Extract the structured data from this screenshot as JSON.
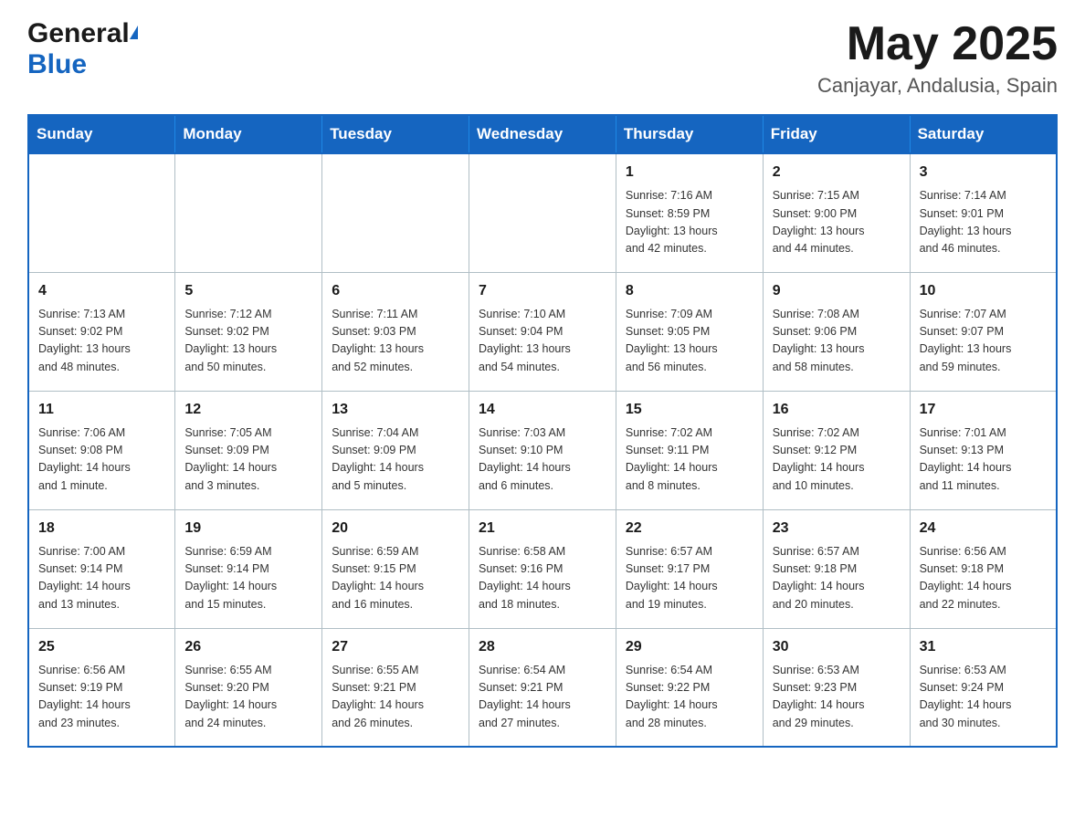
{
  "header": {
    "logo_general": "General",
    "logo_blue": "Blue",
    "month_title": "May 2025",
    "location": "Canjayar, Andalusia, Spain"
  },
  "weekdays": [
    "Sunday",
    "Monday",
    "Tuesday",
    "Wednesday",
    "Thursday",
    "Friday",
    "Saturday"
  ],
  "weeks": [
    [
      {
        "day": "",
        "info": ""
      },
      {
        "day": "",
        "info": ""
      },
      {
        "day": "",
        "info": ""
      },
      {
        "day": "",
        "info": ""
      },
      {
        "day": "1",
        "info": "Sunrise: 7:16 AM\nSunset: 8:59 PM\nDaylight: 13 hours\nand 42 minutes."
      },
      {
        "day": "2",
        "info": "Sunrise: 7:15 AM\nSunset: 9:00 PM\nDaylight: 13 hours\nand 44 minutes."
      },
      {
        "day": "3",
        "info": "Sunrise: 7:14 AM\nSunset: 9:01 PM\nDaylight: 13 hours\nand 46 minutes."
      }
    ],
    [
      {
        "day": "4",
        "info": "Sunrise: 7:13 AM\nSunset: 9:02 PM\nDaylight: 13 hours\nand 48 minutes."
      },
      {
        "day": "5",
        "info": "Sunrise: 7:12 AM\nSunset: 9:02 PM\nDaylight: 13 hours\nand 50 minutes."
      },
      {
        "day": "6",
        "info": "Sunrise: 7:11 AM\nSunset: 9:03 PM\nDaylight: 13 hours\nand 52 minutes."
      },
      {
        "day": "7",
        "info": "Sunrise: 7:10 AM\nSunset: 9:04 PM\nDaylight: 13 hours\nand 54 minutes."
      },
      {
        "day": "8",
        "info": "Sunrise: 7:09 AM\nSunset: 9:05 PM\nDaylight: 13 hours\nand 56 minutes."
      },
      {
        "day": "9",
        "info": "Sunrise: 7:08 AM\nSunset: 9:06 PM\nDaylight: 13 hours\nand 58 minutes."
      },
      {
        "day": "10",
        "info": "Sunrise: 7:07 AM\nSunset: 9:07 PM\nDaylight: 13 hours\nand 59 minutes."
      }
    ],
    [
      {
        "day": "11",
        "info": "Sunrise: 7:06 AM\nSunset: 9:08 PM\nDaylight: 14 hours\nand 1 minute."
      },
      {
        "day": "12",
        "info": "Sunrise: 7:05 AM\nSunset: 9:09 PM\nDaylight: 14 hours\nand 3 minutes."
      },
      {
        "day": "13",
        "info": "Sunrise: 7:04 AM\nSunset: 9:09 PM\nDaylight: 14 hours\nand 5 minutes."
      },
      {
        "day": "14",
        "info": "Sunrise: 7:03 AM\nSunset: 9:10 PM\nDaylight: 14 hours\nand 6 minutes."
      },
      {
        "day": "15",
        "info": "Sunrise: 7:02 AM\nSunset: 9:11 PM\nDaylight: 14 hours\nand 8 minutes."
      },
      {
        "day": "16",
        "info": "Sunrise: 7:02 AM\nSunset: 9:12 PM\nDaylight: 14 hours\nand 10 minutes."
      },
      {
        "day": "17",
        "info": "Sunrise: 7:01 AM\nSunset: 9:13 PM\nDaylight: 14 hours\nand 11 minutes."
      }
    ],
    [
      {
        "day": "18",
        "info": "Sunrise: 7:00 AM\nSunset: 9:14 PM\nDaylight: 14 hours\nand 13 minutes."
      },
      {
        "day": "19",
        "info": "Sunrise: 6:59 AM\nSunset: 9:14 PM\nDaylight: 14 hours\nand 15 minutes."
      },
      {
        "day": "20",
        "info": "Sunrise: 6:59 AM\nSunset: 9:15 PM\nDaylight: 14 hours\nand 16 minutes."
      },
      {
        "day": "21",
        "info": "Sunrise: 6:58 AM\nSunset: 9:16 PM\nDaylight: 14 hours\nand 18 minutes."
      },
      {
        "day": "22",
        "info": "Sunrise: 6:57 AM\nSunset: 9:17 PM\nDaylight: 14 hours\nand 19 minutes."
      },
      {
        "day": "23",
        "info": "Sunrise: 6:57 AM\nSunset: 9:18 PM\nDaylight: 14 hours\nand 20 minutes."
      },
      {
        "day": "24",
        "info": "Sunrise: 6:56 AM\nSunset: 9:18 PM\nDaylight: 14 hours\nand 22 minutes."
      }
    ],
    [
      {
        "day": "25",
        "info": "Sunrise: 6:56 AM\nSunset: 9:19 PM\nDaylight: 14 hours\nand 23 minutes."
      },
      {
        "day": "26",
        "info": "Sunrise: 6:55 AM\nSunset: 9:20 PM\nDaylight: 14 hours\nand 24 minutes."
      },
      {
        "day": "27",
        "info": "Sunrise: 6:55 AM\nSunset: 9:21 PM\nDaylight: 14 hours\nand 26 minutes."
      },
      {
        "day": "28",
        "info": "Sunrise: 6:54 AM\nSunset: 9:21 PM\nDaylight: 14 hours\nand 27 minutes."
      },
      {
        "day": "29",
        "info": "Sunrise: 6:54 AM\nSunset: 9:22 PM\nDaylight: 14 hours\nand 28 minutes."
      },
      {
        "day": "30",
        "info": "Sunrise: 6:53 AM\nSunset: 9:23 PM\nDaylight: 14 hours\nand 29 minutes."
      },
      {
        "day": "31",
        "info": "Sunrise: 6:53 AM\nSunset: 9:24 PM\nDaylight: 14 hours\nand 30 minutes."
      }
    ]
  ]
}
